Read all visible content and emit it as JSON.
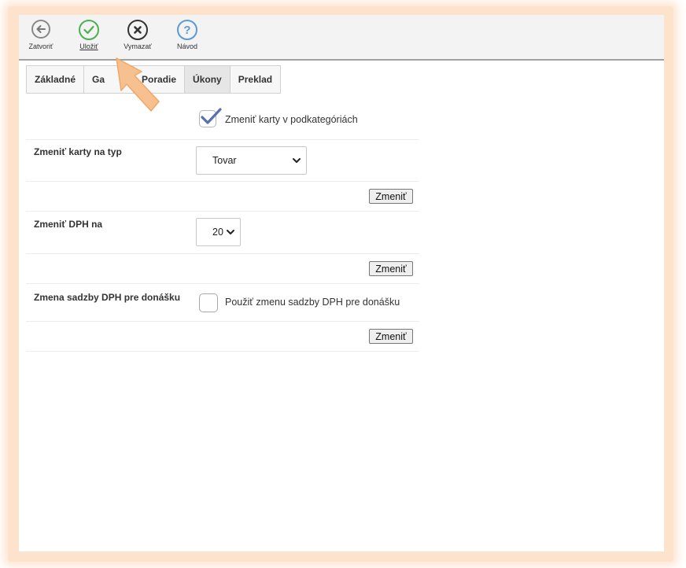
{
  "toolbar": {
    "buttons": [
      {
        "label": "Zatvoriť",
        "icon": "arrow-left-circle-icon",
        "color": "#888888"
      },
      {
        "label": "Uložiť",
        "icon": "check-circle-icon",
        "color": "#4caf50"
      },
      {
        "label": "Vymazať",
        "icon": "close-circle-icon",
        "color": "#333333"
      },
      {
        "label": "Návod",
        "icon": "help-circle-icon",
        "color": "#5b9bd5"
      }
    ]
  },
  "tabs": [
    {
      "label": "Základné",
      "active": false
    },
    {
      "label": "Ga",
      "active": false
    },
    {
      "label": "Poradie",
      "active": false
    },
    {
      "label": "Úkony",
      "active": true
    },
    {
      "label": "Preklad",
      "active": false
    }
  ],
  "form": {
    "subcategory_checkbox": {
      "label": "Zmeniť karty v podkategóriách",
      "checked": true
    },
    "card_type": {
      "label": "Zmeniť karty na typ",
      "value": "Tovar",
      "button": "Zmeniť"
    },
    "vat": {
      "label": "Zmeniť DPH na",
      "value": "20",
      "button": "Zmeniť"
    },
    "delivery_vat": {
      "label": "Zmena sadzby DPH pre donášku",
      "checkbox_label": "Použiť zmenu sadzby DPH pre donášku",
      "checked": false,
      "button": "Zmeniť"
    }
  },
  "colors": {
    "frame_glow": "#fde2cc",
    "pointer_arrow": "#f7c08f",
    "checkmark": "#5a6fb0"
  }
}
